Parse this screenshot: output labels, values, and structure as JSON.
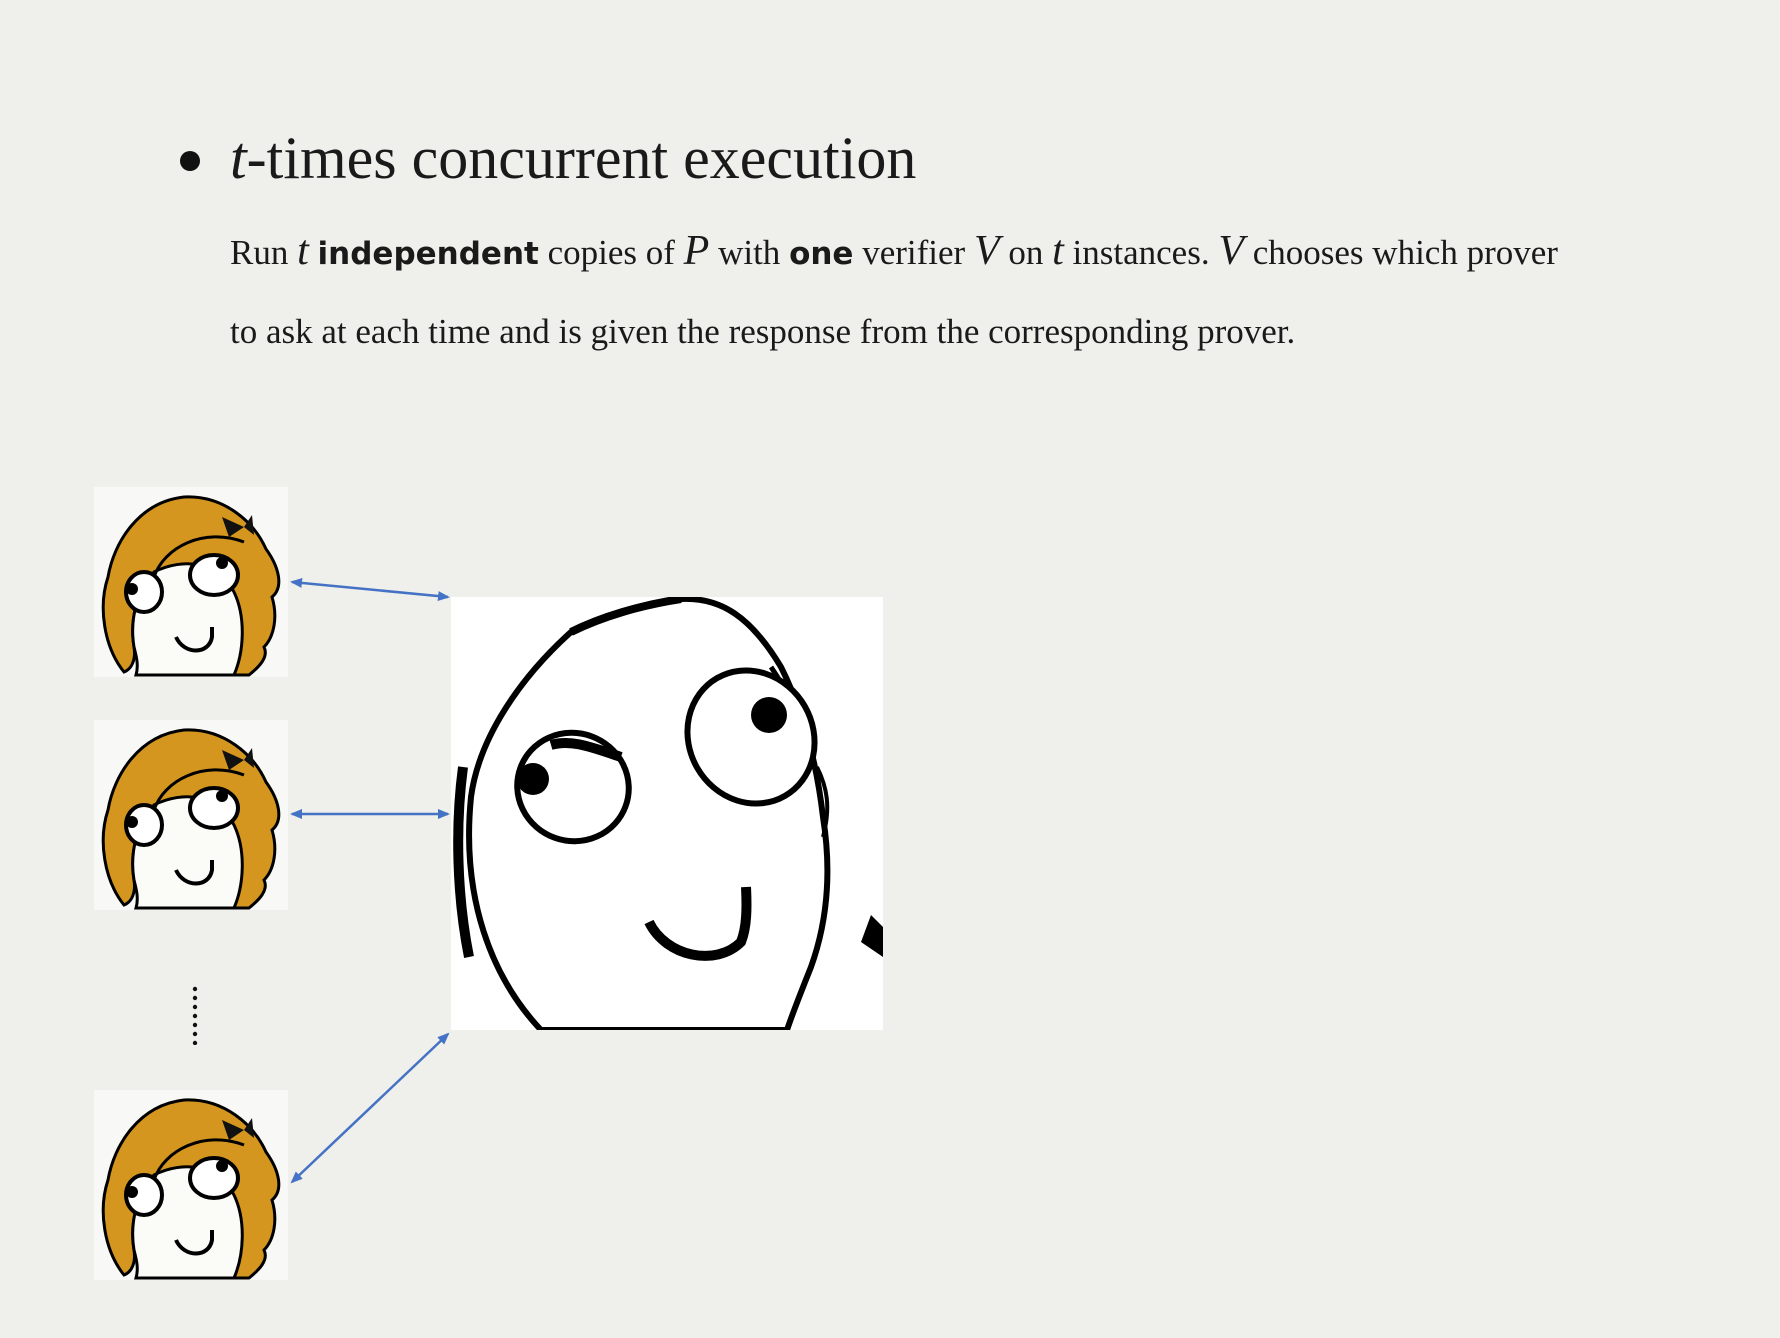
{
  "slide": {
    "heading": {
      "math": "t",
      "text": "-times concurrent execution"
    },
    "body": {
      "seg1": "Run ",
      "math_t1": "t",
      "bold_independent": "independent",
      "seg2": " copies of ",
      "math_P": "P",
      "seg3": " with ",
      "bold_one": "one",
      "seg4": " verifier ",
      "math_V1": "V",
      "seg5": " on ",
      "math_t2": "t",
      "seg6": " instances. ",
      "math_V2": "V",
      "seg7": " chooses which prover to ask at each time and is given the response from the corresponding prover."
    }
  },
  "diagram": {
    "provers": [
      {
        "icon": "derpina-face-icon"
      },
      {
        "icon": "derpina-face-icon"
      },
      {
        "icon": "derpina-face-icon"
      }
    ],
    "ellipsis": "vertical-dots",
    "verifier": {
      "icon": "derp-face-icon"
    },
    "colors": {
      "arrow": "#4472c4",
      "hair": "#d4961e",
      "line": "#000000",
      "background": "#efefeb"
    }
  }
}
